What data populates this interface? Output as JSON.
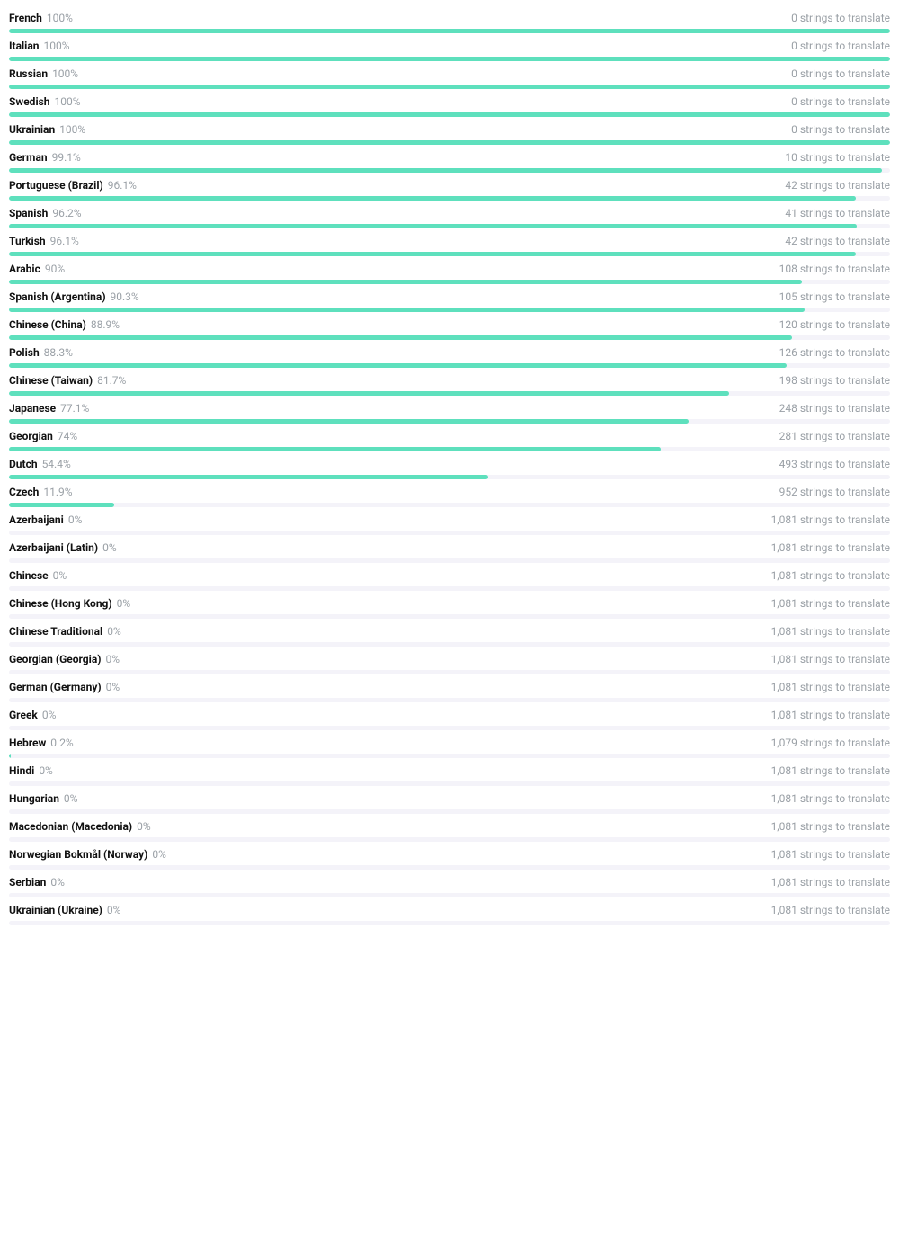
{
  "suffix_template": "strings to translate",
  "languages": [
    {
      "name": "French",
      "pct": "100%",
      "pct_val": 100,
      "remaining": "0"
    },
    {
      "name": "Italian",
      "pct": "100%",
      "pct_val": 100,
      "remaining": "0"
    },
    {
      "name": "Russian",
      "pct": "100%",
      "pct_val": 100,
      "remaining": "0"
    },
    {
      "name": "Swedish",
      "pct": "100%",
      "pct_val": 100,
      "remaining": "0"
    },
    {
      "name": "Ukrainian",
      "pct": "100%",
      "pct_val": 100,
      "remaining": "0"
    },
    {
      "name": "German",
      "pct": "99.1%",
      "pct_val": 99.1,
      "remaining": "10"
    },
    {
      "name": "Portuguese (Brazil)",
      "pct": "96.1%",
      "pct_val": 96.1,
      "remaining": "42"
    },
    {
      "name": "Spanish",
      "pct": "96.2%",
      "pct_val": 96.2,
      "remaining": "41"
    },
    {
      "name": "Turkish",
      "pct": "96.1%",
      "pct_val": 96.1,
      "remaining": "42"
    },
    {
      "name": "Arabic",
      "pct": "90%",
      "pct_val": 90,
      "remaining": "108"
    },
    {
      "name": "Spanish (Argentina)",
      "pct": "90.3%",
      "pct_val": 90.3,
      "remaining": "105"
    },
    {
      "name": "Chinese (China)",
      "pct": "88.9%",
      "pct_val": 88.9,
      "remaining": "120"
    },
    {
      "name": "Polish",
      "pct": "88.3%",
      "pct_val": 88.3,
      "remaining": "126"
    },
    {
      "name": "Chinese (Taiwan)",
      "pct": "81.7%",
      "pct_val": 81.7,
      "remaining": "198"
    },
    {
      "name": "Japanese",
      "pct": "77.1%",
      "pct_val": 77.1,
      "remaining": "248"
    },
    {
      "name": "Georgian",
      "pct": "74%",
      "pct_val": 74,
      "remaining": "281"
    },
    {
      "name": "Dutch",
      "pct": "54.4%",
      "pct_val": 54.4,
      "remaining": "493"
    },
    {
      "name": "Czech",
      "pct": "11.9%",
      "pct_val": 11.9,
      "remaining": "952"
    },
    {
      "name": "Azerbaijani",
      "pct": "0%",
      "pct_val": 0,
      "remaining": "1,081"
    },
    {
      "name": "Azerbaijani (Latin)",
      "pct": "0%",
      "pct_val": 0,
      "remaining": "1,081"
    },
    {
      "name": "Chinese",
      "pct": "0%",
      "pct_val": 0,
      "remaining": "1,081"
    },
    {
      "name": "Chinese (Hong Kong)",
      "pct": "0%",
      "pct_val": 0,
      "remaining": "1,081"
    },
    {
      "name": "Chinese Traditional",
      "pct": "0%",
      "pct_val": 0,
      "remaining": "1,081"
    },
    {
      "name": "Georgian (Georgia)",
      "pct": "0%",
      "pct_val": 0,
      "remaining": "1,081"
    },
    {
      "name": "German (Germany)",
      "pct": "0%",
      "pct_val": 0,
      "remaining": "1,081"
    },
    {
      "name": "Greek",
      "pct": "0%",
      "pct_val": 0,
      "remaining": "1,081"
    },
    {
      "name": "Hebrew",
      "pct": "0.2%",
      "pct_val": 0.2,
      "remaining": "1,079"
    },
    {
      "name": "Hindi",
      "pct": "0%",
      "pct_val": 0,
      "remaining": "1,081"
    },
    {
      "name": "Hungarian",
      "pct": "0%",
      "pct_val": 0,
      "remaining": "1,081"
    },
    {
      "name": "Macedonian (Macedonia)",
      "pct": "0%",
      "pct_val": 0,
      "remaining": "1,081"
    },
    {
      "name": "Norwegian Bokmål (Norway)",
      "pct": "0%",
      "pct_val": 0,
      "remaining": "1,081"
    },
    {
      "name": "Serbian",
      "pct": "0%",
      "pct_val": 0,
      "remaining": "1,081"
    },
    {
      "name": "Ukrainian (Ukraine)",
      "pct": "0%",
      "pct_val": 0,
      "remaining": "1,081"
    }
  ]
}
